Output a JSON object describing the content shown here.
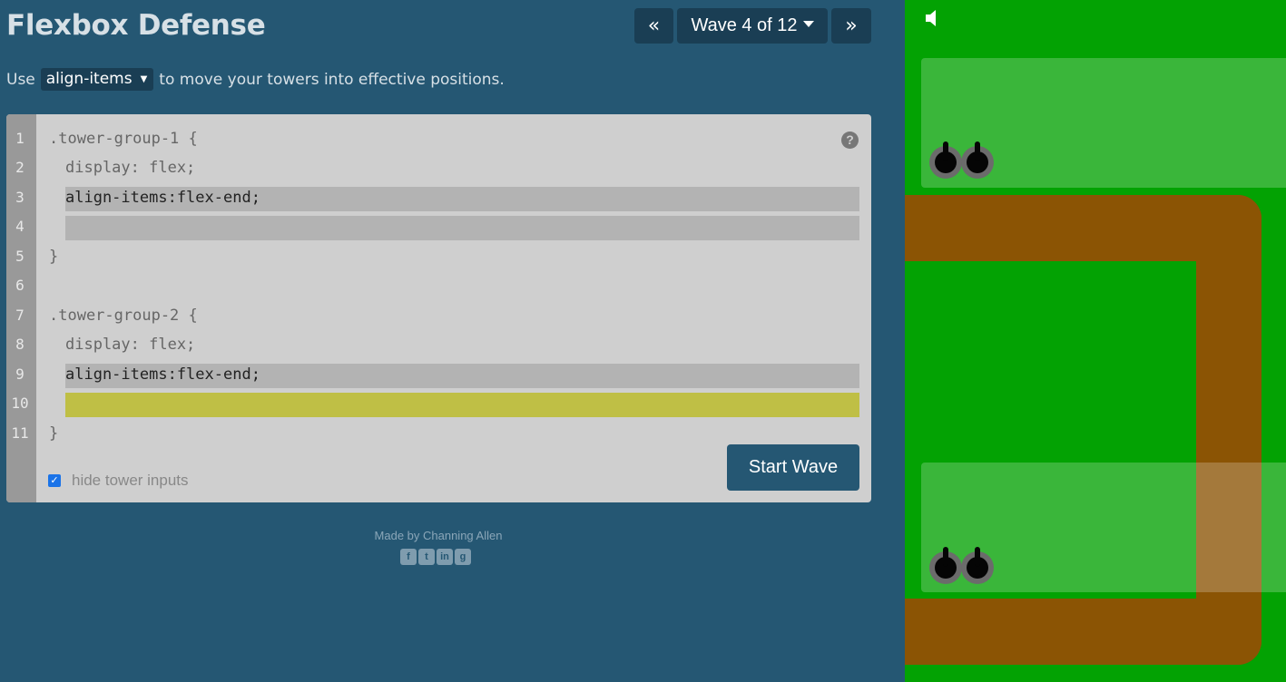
{
  "app": {
    "title": "Flexbox Defense"
  },
  "nav": {
    "prev_icon": "«",
    "level_label": "Wave 4 of 12",
    "next_icon": "»"
  },
  "instructions": {
    "prefix": "Use",
    "property": "align-items",
    "suffix": "to move your towers into effective positions."
  },
  "editor": {
    "line_numbers": [
      "1",
      "2",
      "3",
      "4",
      "5",
      "6",
      "7",
      "8",
      "9",
      "10",
      "11"
    ],
    "lines": {
      "l1": ".tower-group-1 {",
      "l2": "display: flex;",
      "l3": "align-items:flex-end;",
      "l4": "",
      "l5": "}",
      "l7": ".tower-group-2 {",
      "l8": "display: flex;",
      "l9": "align-items:flex-end;",
      "l10": "",
      "l11": "}"
    },
    "help_icon": "?",
    "start_button": "Start Wave",
    "hide_inputs": {
      "label": "hide tower inputs",
      "checked": true
    }
  },
  "footer": {
    "credit": "Made by Channing Allen",
    "social_icons": [
      "facebook-icon",
      "twitter-icon",
      "linkedin-icon",
      "github-icon"
    ]
  },
  "board": {
    "colors": {
      "grass": "#03a203",
      "path": "#8b5404",
      "zone": "rgba(255,255,255,0.22)",
      "tower_base": "#6b6b6b"
    },
    "tower_groups": [
      {
        "name": "tower-group-1",
        "towers": 2
      },
      {
        "name": "tower-group-2",
        "towers": 2
      }
    ]
  }
}
